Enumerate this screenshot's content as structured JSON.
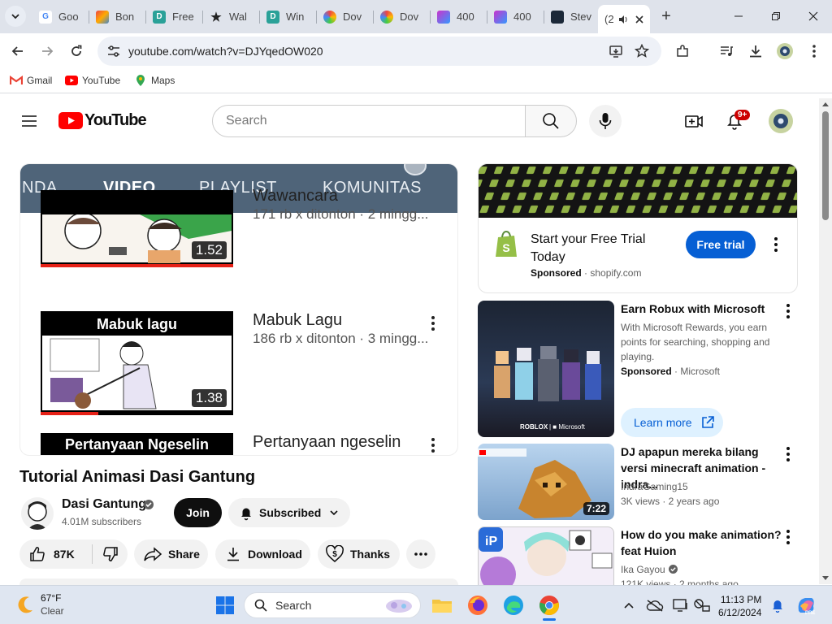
{
  "browser": {
    "tabs": [
      {
        "title": "Goo",
        "icon": "google-icon"
      },
      {
        "title": "Bon",
        "icon": "bon-icon"
      },
      {
        "title": "Free",
        "icon": "d-icon"
      },
      {
        "title": "Wal",
        "icon": "star-icon"
      },
      {
        "title": "Win",
        "icon": "d-icon"
      },
      {
        "title": "Dov",
        "icon": "ring-icon"
      },
      {
        "title": "Dov",
        "icon": "ring-icon"
      },
      {
        "title": "400",
        "icon": "image-icon"
      },
      {
        "title": "400",
        "icon": "image-icon"
      },
      {
        "title": "Stev",
        "icon": "steam-icon"
      },
      {
        "title": "(2",
        "icon": "youtube-icon",
        "active": true
      }
    ],
    "url": "youtube.com/watch?v=DJYqedOW020",
    "bookmarks": [
      "Gmail",
      "YouTube",
      "Maps"
    ]
  },
  "youtube": {
    "logo_text": "YouTube",
    "search_placeholder": "Search",
    "notifications_badge": "9+"
  },
  "player": {
    "channel_tabs": [
      "NDA",
      "VIDEO",
      "PLAYLIST",
      "KOMUNITAS"
    ],
    "videos": [
      {
        "title": "Wawancara",
        "meta": "171 rb x ditonton · 2 mingg...",
        "duration": "1.52",
        "thumb_text": ""
      },
      {
        "title": "Mabuk Lagu",
        "meta": "186 rb x ditonton · 3 mingg...",
        "duration": "1.38",
        "thumb_text": "Mabuk lagu"
      },
      {
        "title": "Pertanyaan ngeselin",
        "meta": "",
        "duration": "",
        "thumb_text": "Pertanyaan Ngeselin"
      }
    ]
  },
  "video": {
    "title": "Tutorial Animasi Dasi Gantung",
    "channel": "Dasi Gantung",
    "subscribers": "4.01M subscribers",
    "join_label": "Join",
    "subscribed_label": "Subscribed",
    "like_count": "87K",
    "share_label": "Share",
    "download_label": "Download",
    "thanks_label": "Thanks"
  },
  "ad": {
    "title": "Start your Free Trial Today",
    "sponsored": "Sponsored",
    "domain": "shopify.com",
    "cta": "Free trial"
  },
  "recommendations": [
    {
      "title": "Earn Robux with Microsoft",
      "desc": "With Microsoft Rewards, you earn points for searching, shopping and playing.",
      "line1": "Sponsored",
      "line2": "Microsoft",
      "cta": "Learn more",
      "duration": ""
    },
    {
      "title": "DJ apapun mereka bilang versi minecraft animation - indra...",
      "line1": "IndraGaming15",
      "line2": "3K views · 2 years ago",
      "duration": "7:22"
    },
    {
      "title": "How do you make animation? feat Huion",
      "line1": "Ika Gayou",
      "line2": "121K views · 2 months ago",
      "duration": ""
    }
  ],
  "taskbar": {
    "weather_temp": "67°F",
    "weather_desc": "Clear",
    "search_label": "Search",
    "time": "11:13 PM",
    "date": "6/12/2024"
  },
  "colors": {
    "youtube_red": "#ff0000",
    "accent_blue": "#065fd4",
    "channel_bar": "#4f6479"
  }
}
